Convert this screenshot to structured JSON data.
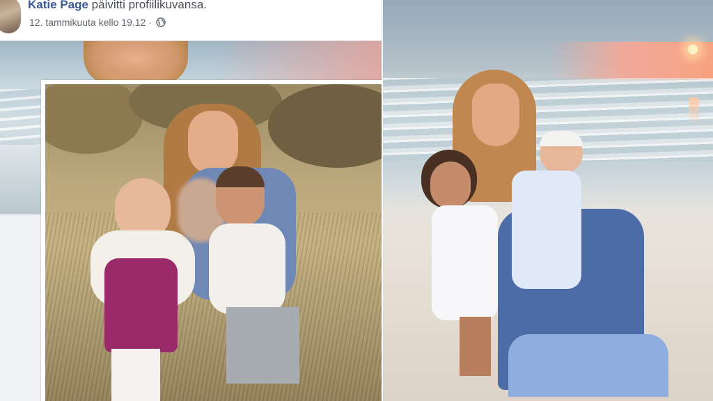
{
  "post": {
    "poster_name": "Katie Page",
    "action_text": "päivitti profiilikuvansa.",
    "timestamp": "12. tammikuuta kello 19.12",
    "audience_icon": "globe-icon"
  },
  "colors": {
    "name_link": "#385898",
    "meta_text": "#616770",
    "header_bg": "#ffffff"
  }
}
